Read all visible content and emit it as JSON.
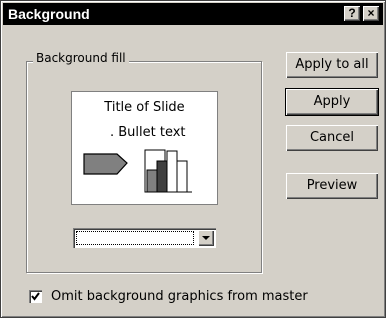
{
  "dialog": {
    "title": "Background",
    "help_label": "?",
    "close_label": "×"
  },
  "fill_group": {
    "label": "Background fill",
    "preview": {
      "title": "Title of Slide",
      "bullet": ". Bullet text"
    },
    "color_combo": {
      "value": ""
    }
  },
  "buttons": {
    "apply_all": "Apply to all",
    "apply": "Apply",
    "cancel": "Cancel",
    "preview": "Preview"
  },
  "omit_checkbox": {
    "label": "Omit background graphics from master",
    "checked": true
  }
}
